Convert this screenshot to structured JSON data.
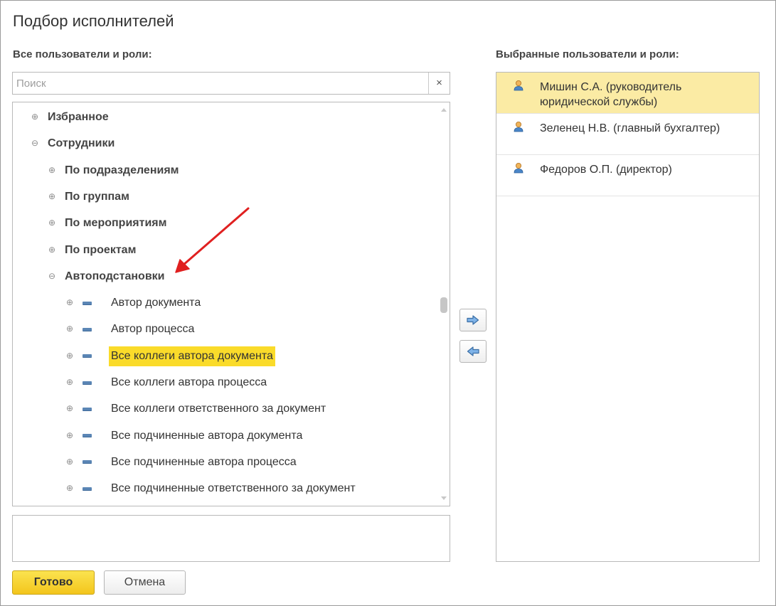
{
  "window": {
    "title": "Подбор исполнителей"
  },
  "left_panel": {
    "label": "Все пользователи и роли:",
    "search": {
      "placeholder": "Поиск",
      "value": "",
      "clear_glyph": "×"
    },
    "tree": [
      {
        "label": "Избранное",
        "expander": "plus",
        "bold": true,
        "level": 0
      },
      {
        "label": "Сотрудники",
        "expander": "minus",
        "bold": true,
        "level": 0
      },
      {
        "label": "По подразделениям",
        "expander": "plus",
        "bold": true,
        "level": 1
      },
      {
        "label": "По группам",
        "expander": "plus",
        "bold": true,
        "level": 1
      },
      {
        "label": "По мероприятиям",
        "expander": "plus",
        "bold": true,
        "level": 1
      },
      {
        "label": "По проектам",
        "expander": "plus",
        "bold": true,
        "level": 1
      },
      {
        "label": "Автоподстановки",
        "expander": "minus",
        "bold": true,
        "level": 1
      },
      {
        "label": "Автор документа",
        "expander": "plus",
        "bold": false,
        "level": 2,
        "icon": "role-icon"
      },
      {
        "label": "Автор процесса",
        "expander": "plus",
        "bold": false,
        "level": 2,
        "icon": "role-icon"
      },
      {
        "label": "Все коллеги автора документа",
        "expander": "plus",
        "bold": false,
        "level": 2,
        "icon": "role-icon",
        "selected": true
      },
      {
        "label": "Все коллеги автора процесса",
        "expander": "plus",
        "bold": false,
        "level": 2,
        "icon": "role-icon"
      },
      {
        "label": "Все коллеги ответственного за документ",
        "expander": "plus",
        "bold": false,
        "level": 2,
        "icon": "role-icon"
      },
      {
        "label": "Все подчиненные автора документа",
        "expander": "plus",
        "bold": false,
        "level": 2,
        "icon": "role-icon"
      },
      {
        "label": "Все подчиненные автора процесса",
        "expander": "plus",
        "bold": false,
        "level": 2,
        "icon": "role-icon"
      },
      {
        "label": "Все подчиненные ответственного за документ",
        "expander": "plus",
        "bold": false,
        "level": 2,
        "icon": "role-icon"
      }
    ],
    "description": ""
  },
  "transfer_buttons": {
    "add_icon": "arrow-right-icon",
    "remove_icon": "arrow-left-icon"
  },
  "right_panel": {
    "label": "Выбранные пользователи и роли:",
    "items": [
      {
        "name": "Мишин С.А. (руководитель юридической службы)",
        "icon": "user-icon",
        "selected": true
      },
      {
        "name": "Зеленец Н.В. (главный бухгалтер)",
        "icon": "user-icon",
        "selected": false
      },
      {
        "name": "Федоров О.П. (директор)",
        "icon": "user-icon",
        "selected": false
      }
    ]
  },
  "footer": {
    "done_label": "Готово",
    "cancel_label": "Отмена"
  },
  "colors": {
    "accent_yellow": "#fadb2a",
    "selection_light": "#fbeba4",
    "annotation_red": "#e02020"
  }
}
